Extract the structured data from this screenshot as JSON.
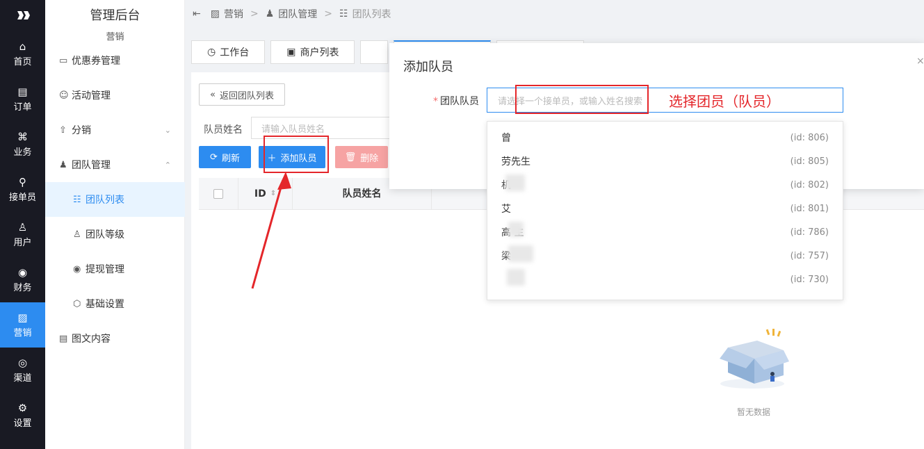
{
  "nav": {
    "items": [
      {
        "label": "首页",
        "icon": "home-icon",
        "glyph": "⌂"
      },
      {
        "label": "订单",
        "icon": "order-icon",
        "glyph": "▤"
      },
      {
        "label": "业务",
        "icon": "business-icon",
        "glyph": "⌘"
      },
      {
        "label": "接单员",
        "icon": "bike-icon",
        "glyph": "⚲"
      },
      {
        "label": "用户",
        "icon": "user-icon",
        "glyph": "♙"
      },
      {
        "label": "财务",
        "icon": "finance-icon",
        "glyph": "◉"
      },
      {
        "label": "营销",
        "icon": "marketing-icon",
        "glyph": "▨"
      },
      {
        "label": "渠道",
        "icon": "channel-icon",
        "glyph": "◎"
      },
      {
        "label": "设置",
        "icon": "settings-icon",
        "glyph": "⚙"
      }
    ],
    "active": "营销"
  },
  "sidebar": {
    "title": "管理后台",
    "subtitle": "营销",
    "menu": [
      {
        "label": "优惠券管理",
        "glyph": "▭"
      },
      {
        "label": "活动管理",
        "glyph": "☺"
      },
      {
        "label": "分销",
        "glyph": "⇧",
        "arrow": "⌄"
      },
      {
        "label": "团队管理",
        "glyph": "♟",
        "arrow": "⌃"
      },
      {
        "label": "团队列表",
        "glyph": "☷",
        "sub": true,
        "active": true
      },
      {
        "label": "团队等级",
        "glyph": "♙",
        "sub": true
      },
      {
        "label": "提现管理",
        "glyph": "◉",
        "sub": true
      },
      {
        "label": "基础设置",
        "glyph": "⬡",
        "sub": true
      },
      {
        "label": "图文内容",
        "glyph": "▤"
      }
    ]
  },
  "breadcrumb": {
    "toggle": "⇤",
    "items": [
      "营销",
      "团队管理",
      "团队列表"
    ],
    "sep": ">"
  },
  "tabs": [
    {
      "label": "工作台",
      "glyph": "◷"
    },
    {
      "label": "商户列表",
      "glyph": "▣"
    }
  ],
  "page": {
    "back_label": "返回团队列表",
    "back_glyph": "«",
    "filter_label": "队员姓名",
    "filter_placeholder": "请输入队员姓名",
    "refresh_label": "刷新",
    "add_label": "添加队员",
    "delete_label": "删除",
    "col_id": "ID",
    "col_name": "队员姓名",
    "empty": "暂无数据"
  },
  "modal": {
    "title": "添加队员",
    "field_label": "团队队员",
    "required_mark": "*",
    "placeholder": "请选择一个接单员，或输入姓名搜索",
    "close": "×"
  },
  "dropdown": [
    {
      "name": "曾",
      "id": "(id: 806)"
    },
    {
      "name": "劳先生",
      "id": "(id: 805)"
    },
    {
      "name": "机",
      "id": "(id: 802)"
    },
    {
      "name": "艾",
      "id": "(id: 801)"
    },
    {
      "name": "高 生",
      "id": "(id: 786)"
    },
    {
      "name": "梁",
      "id": "(id: 757)"
    },
    {
      "name": "",
      "id": "(id: 730)"
    }
  ],
  "annotation": {
    "text": "选择团员（队员）",
    "color": "#e4262a"
  },
  "colors": {
    "accent": "#2d8cf0",
    "nav_bg": "#191a23",
    "danger_light": "#f6a3a3"
  }
}
